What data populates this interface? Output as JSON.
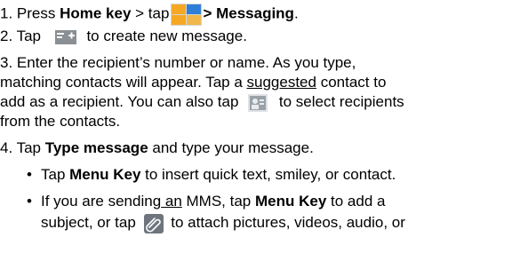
{
  "step1": {
    "prefix": "1. Press ",
    "bold1": "Home key",
    "mid": " > tap",
    "suffix_bold": "> Messaging",
    "end": "."
  },
  "step2": {
    "prefix": "2. Tap ",
    "suffix": " to create new message."
  },
  "step3": {
    "line1": "3. Enter the recipient’s number or name. As you type,",
    "line2_pre": "matching contacts will appear. Tap a ",
    "line2_link": "suggested",
    "line2_post": " contact to",
    "line3_pre": "add as a recipient. You can also tap ",
    "line3_post": " to select recipients",
    "line4": "from the contacts."
  },
  "step4": {
    "prefix": "4. Tap ",
    "bold": "Type message",
    "suffix": " and type your message."
  },
  "bullet1": {
    "prefix": "Tap ",
    "bold": "Menu Key",
    "suffix": " to insert quick text, smiley, or contact."
  },
  "bullet2": {
    "line1_pre": "If you are sending",
    "line1_link": " an",
    "line1_mid": " MMS, tap ",
    "line1_bold": "Menu Key",
    "line1_post": " to add a",
    "line2_pre": "subject, or tap ",
    "line2_post": " to attach pictures, videos, audio, or"
  },
  "bullet_symbol": "•",
  "icons": {
    "launcher": "home-launcher-icon",
    "compose": "compose-message-icon",
    "contacts": "contacts-icon",
    "attach": "paperclip-attach-icon"
  },
  "colors": {
    "text": "#000000",
    "launcher_orange": "#f7a823",
    "launcher_blue": "#2f7fd8",
    "icon_gray": "#8a8f94"
  }
}
